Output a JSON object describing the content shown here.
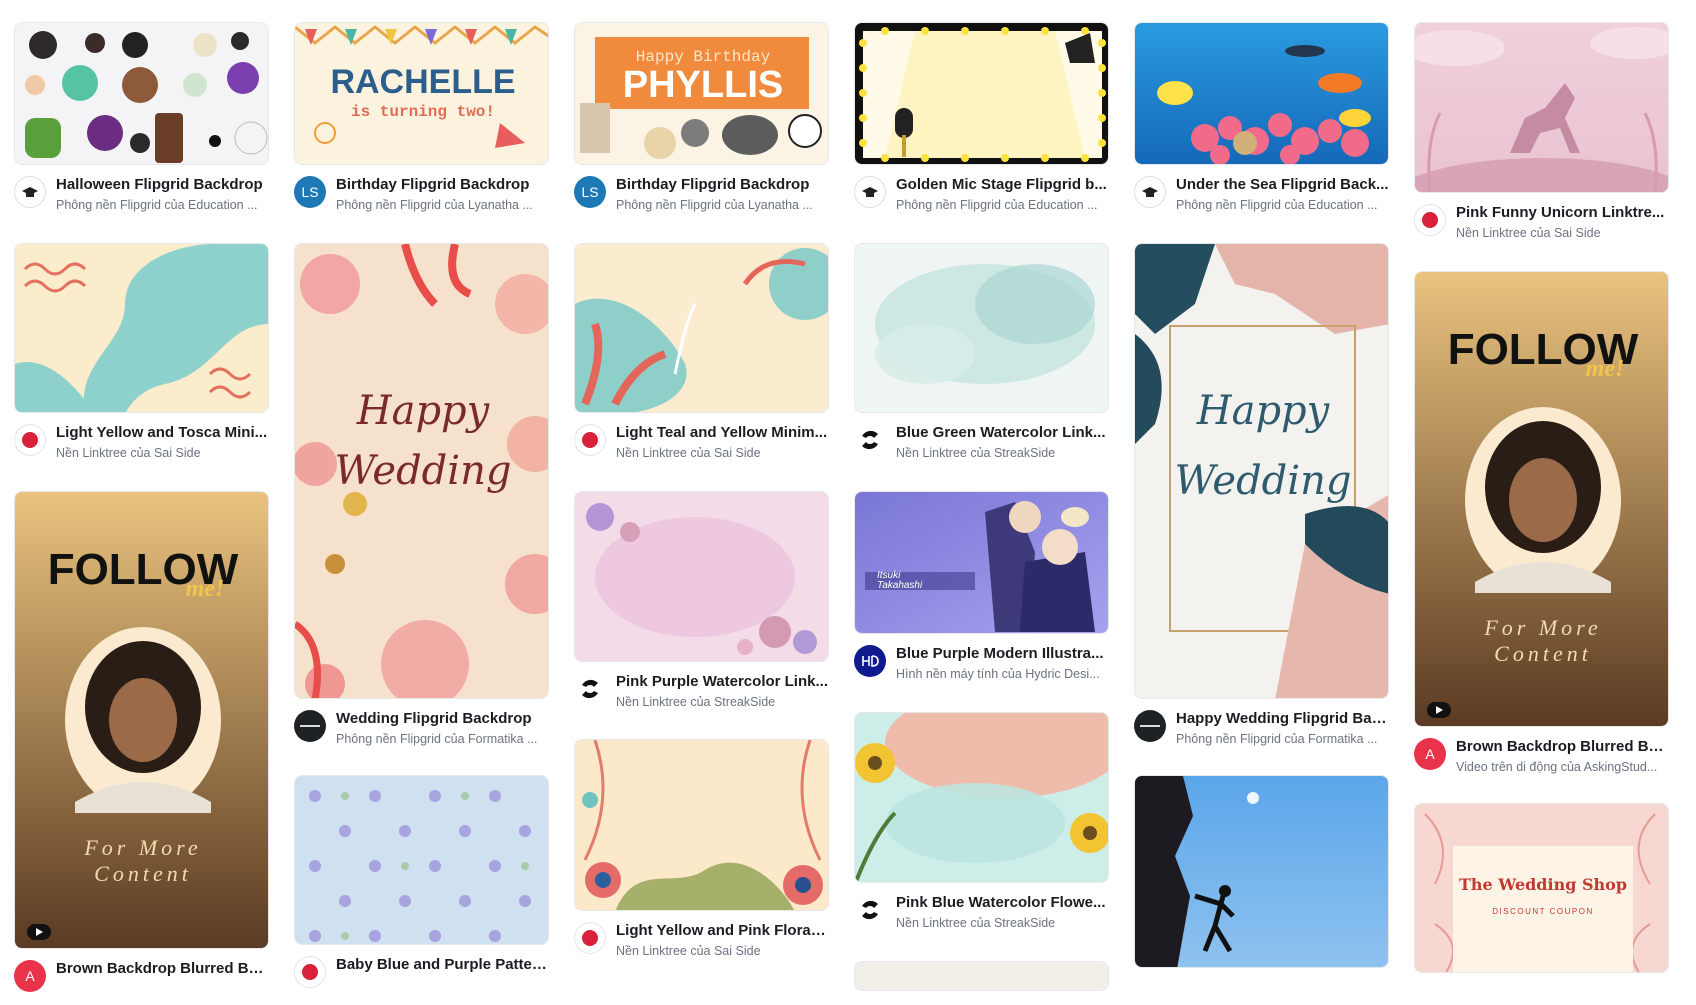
{
  "templates": {
    "halloween": {
      "title": "Halloween Flipgrid Backdrop",
      "subtitle": "Phông nền Flipgrid của Education ..."
    },
    "rachelle": {
      "title": "Birthday Flipgrid Backdrop",
      "subtitle": "Phông nền Flipgrid của Lyanatha ...",
      "heading": "RACHELLE",
      "subheading": "is turning two!"
    },
    "phyllis": {
      "title": "Birthday Flipgrid Backdrop",
      "subtitle": "Phông nền Flipgrid của Lyanatha ...",
      "heading": "Happy Birthday",
      "name": "PHYLLIS"
    },
    "golden_mic": {
      "title": "Golden Mic Stage Flipgrid b...",
      "subtitle": "Phông nền Flipgrid của Education ..."
    },
    "under_sea": {
      "title": "Under the Sea Flipgrid Back...",
      "subtitle": "Phông nền Flipgrid của Education ..."
    },
    "pink_unicorn": {
      "title": "Pink Funny Unicorn Linktre...",
      "subtitle": "Nền Linktree của Sai Side"
    },
    "light_yellow_tosca": {
      "title": "Light Yellow and Tosca Mini...",
      "subtitle": "Nền Linktree của Sai Side"
    },
    "wedding_flipgrid": {
      "title": "Wedding Flipgrid Backdrop",
      "subtitle": "Phông nền Flipgrid của Formatika ...",
      "script_line1": "Happy",
      "script_line2": "Wedding"
    },
    "light_teal_yellow": {
      "title": "Light Teal and Yellow Minim...",
      "subtitle": "Nền Linktree của Sai Side"
    },
    "blue_green_watercolor": {
      "title": "Blue Green Watercolor Link...",
      "subtitle": "Nền Linktree của StreakSide"
    },
    "happy_wedding": {
      "title": "Happy Wedding Flipgrid Bac...",
      "subtitle": "Phông nền Flipgrid của Formatika ...",
      "script_line1": "Happy",
      "script_line2": "Wedding"
    },
    "brown_backdrop_right": {
      "title": "Brown Backdrop Blurred Ba...",
      "subtitle": "Video trên di động của AskingStud...",
      "follow": "FOLLOW",
      "me": "me!",
      "more_line1": "For More",
      "more_line2": "Content"
    },
    "brown_backdrop_left": {
      "title": "Brown Backdrop Blurred Ba...",
      "follow": "FOLLOW",
      "me": "me!",
      "more_line1": "For More",
      "more_line2": "Content"
    },
    "pink_purple_watercolor": {
      "title": "Pink Purple Watercolor Link...",
      "subtitle": "Nền Linktree của StreakSide"
    },
    "blue_purple_modern": {
      "title": "Blue Purple Modern Illustra...",
      "subtitle": "Hình nền máy tính của Hydric Desi...",
      "name_line1": "Itsuki",
      "name_line2": "Takahashi"
    },
    "pink_blue_watercolor": {
      "title": "Pink Blue Watercolor Flowe...",
      "subtitle": "Nền Linktree của StreakSide"
    },
    "light_yellow_pink": {
      "title": "Light Yellow and Pink Floral ...",
      "subtitle": "Nền Linktree của Sai Side"
    },
    "baby_blue_purple": {
      "title": "Baby Blue and Purple Patter..."
    },
    "wedding_shop": {
      "heading": "The Wedding Shop",
      "subheading": "DISCOUNT COUPON"
    }
  },
  "avatars": {
    "ls": "LS",
    "a": "A"
  },
  "colors": {
    "title_text": "#1a1d21",
    "subtitle_text": "#6b7280",
    "ls_avatar": "#1d78b5",
    "sai_side_avatar": "#d7223b",
    "a_avatar": "#e8334a"
  }
}
